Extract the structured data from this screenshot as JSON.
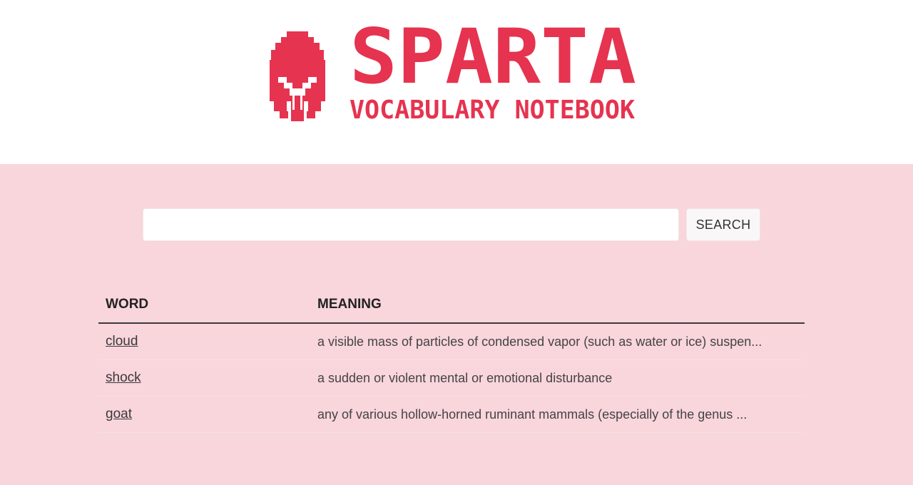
{
  "brand": {
    "title": "SPARTA",
    "subtitle": "VOCABULARY NOTEBOOK",
    "logo_icon": "spartan-helmet-icon",
    "color": "#e6334f"
  },
  "search": {
    "value": "",
    "placeholder": "",
    "button_label": "SEARCH"
  },
  "table": {
    "headers": [
      "WORD",
      "MEANING"
    ],
    "rows": [
      {
        "word": "cloud",
        "meaning": "a visible mass of particles of condensed vapor (such as water or ice) suspen..."
      },
      {
        "word": "shock",
        "meaning": "a sudden or violent mental or emotional disturbance"
      },
      {
        "word": "goat",
        "meaning": "any of various hollow-horned ruminant mammals (especially of the genus ..."
      }
    ]
  },
  "colors": {
    "accent": "#e6334f",
    "background": "#f9d5dc"
  }
}
